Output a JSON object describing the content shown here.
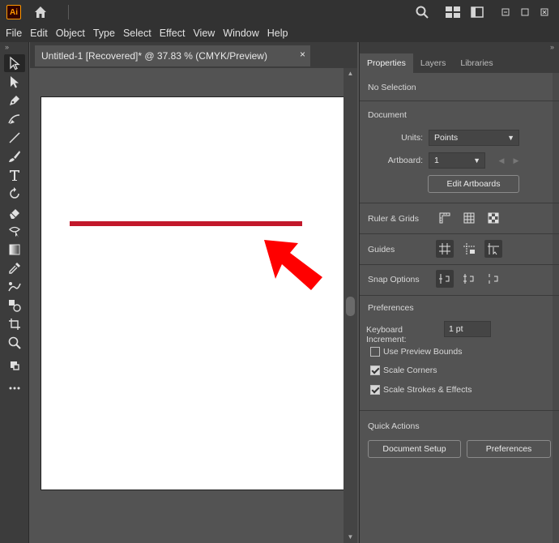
{
  "app": {
    "logo_text": "Ai",
    "accent_color": "#ff9a00"
  },
  "menu": [
    "File",
    "Edit",
    "Object",
    "Type",
    "Select",
    "Effect",
    "View",
    "Window",
    "Help"
  ],
  "document": {
    "tab_title": "Untitled-1 [Recovered]* @ 37.83 % (CMYK/Preview)",
    "close_glyph": "×",
    "stroke_color": "#c2182b"
  },
  "panel": {
    "tabs": [
      "Properties",
      "Layers",
      "Libraries"
    ],
    "selection_state": "No Selection",
    "document_title": "Document",
    "units_label": "Units:",
    "units_value": "Points",
    "artboard_label": "Artboard:",
    "artboard_value": "1",
    "edit_artboards": "Edit Artboards",
    "rulers_grids": "Ruler & Grids",
    "guides": "Guides",
    "snap_options": "Snap Options",
    "preferences_title": "Preferences",
    "keyboard_increment_label": "Keyboard Increment:",
    "keyboard_increment_value": "1 pt",
    "use_preview_bounds": "Use Preview Bounds",
    "scale_corners": "Scale Corners",
    "scale_strokes": "Scale Strokes & Effects",
    "quick_actions": "Quick Actions",
    "document_setup": "Document Setup",
    "preferences_button": "Preferences"
  },
  "checkboxes": {
    "use_preview_bounds": false,
    "scale_corners": true,
    "scale_strokes": true
  },
  "annotation_color": "#ff0000"
}
